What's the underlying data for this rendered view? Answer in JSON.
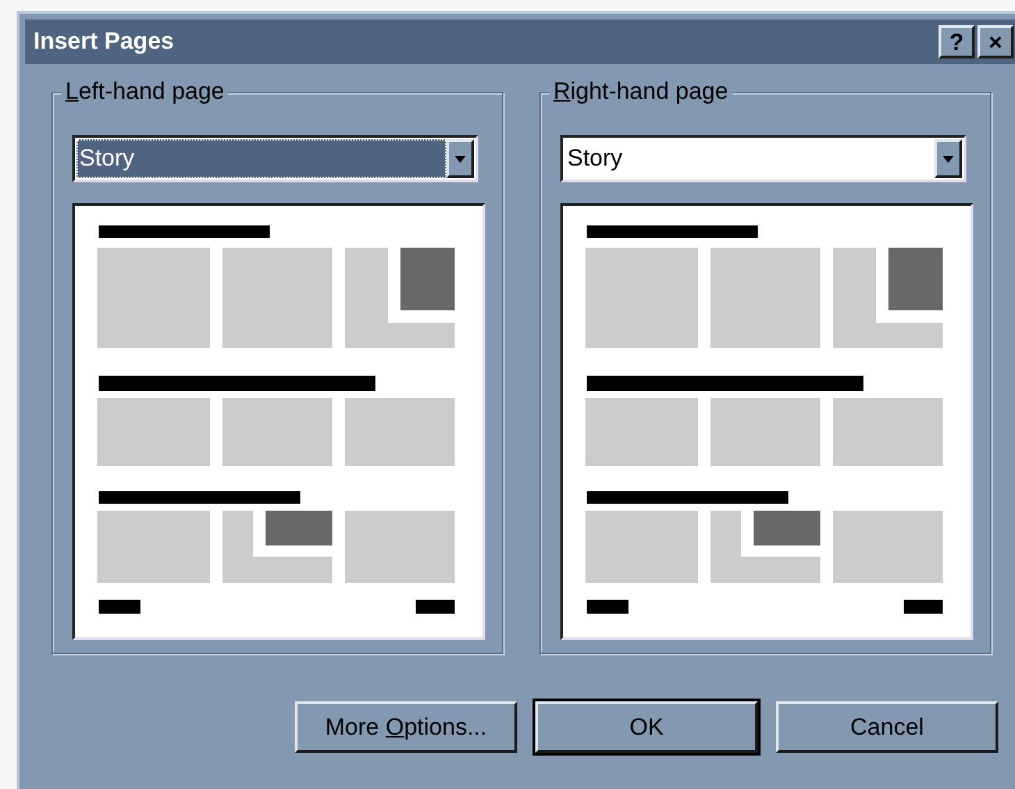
{
  "window": {
    "title": "Insert Pages",
    "title_buttons": [
      "?",
      "×"
    ]
  },
  "pages": [
    {
      "label": {
        "key": "L",
        "after": "eft-hand page"
      },
      "layout": "Story",
      "focused": true
    },
    {
      "label": {
        "key": "R",
        "after": "ight-hand page"
      },
      "layout": "Story",
      "focused": false
    }
  ],
  "buttons": [
    {
      "label": {
        "before": "More ",
        "key": "O",
        "after": "ptions..."
      },
      "default": false
    },
    {
      "label": {
        "before": "OK"
      },
      "default": true
    },
    {
      "label": {
        "before": "Cancel"
      },
      "default": false
    }
  ]
}
